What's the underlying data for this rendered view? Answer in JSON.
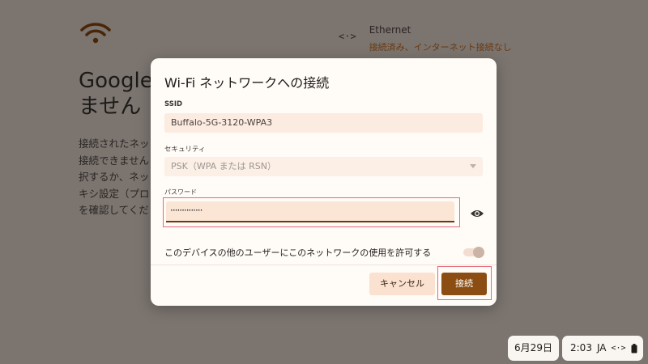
{
  "background": {
    "title": "Google\nません",
    "body": "接続されたネッ\n接続できません\n択するか、ネッ\nキシ設定（プロ\nを確認してくだ",
    "ethernet": {
      "name": "Ethernet",
      "status": "接続済み、インターネット接続なし"
    }
  },
  "dialog": {
    "title": "Wi-Fi ネットワークへの接続",
    "ssid_label": "SSID",
    "ssid_value": "Buffalo-5G-3120-WPA3",
    "security_label": "セキュリティ",
    "security_value": "PSK（WPA または RSN）",
    "password_label": "パスワード",
    "password_value": "··············",
    "share_label": "このデバイスの他のユーザーにこのネットワークの使用を許可する",
    "cancel_label": "キャンセル",
    "connect_label": "接続"
  },
  "taskbar": {
    "date": "6月29日",
    "time": "2:03",
    "ime": "JA"
  },
  "colors": {
    "accent": "#8b4d12",
    "highlight_outline": "#e46b7a"
  },
  "icons": [
    "wifi-icon",
    "ethernet-icon",
    "eye-icon",
    "network-tray-icon",
    "battery-icon",
    "dropdown-arrow-icon"
  ]
}
